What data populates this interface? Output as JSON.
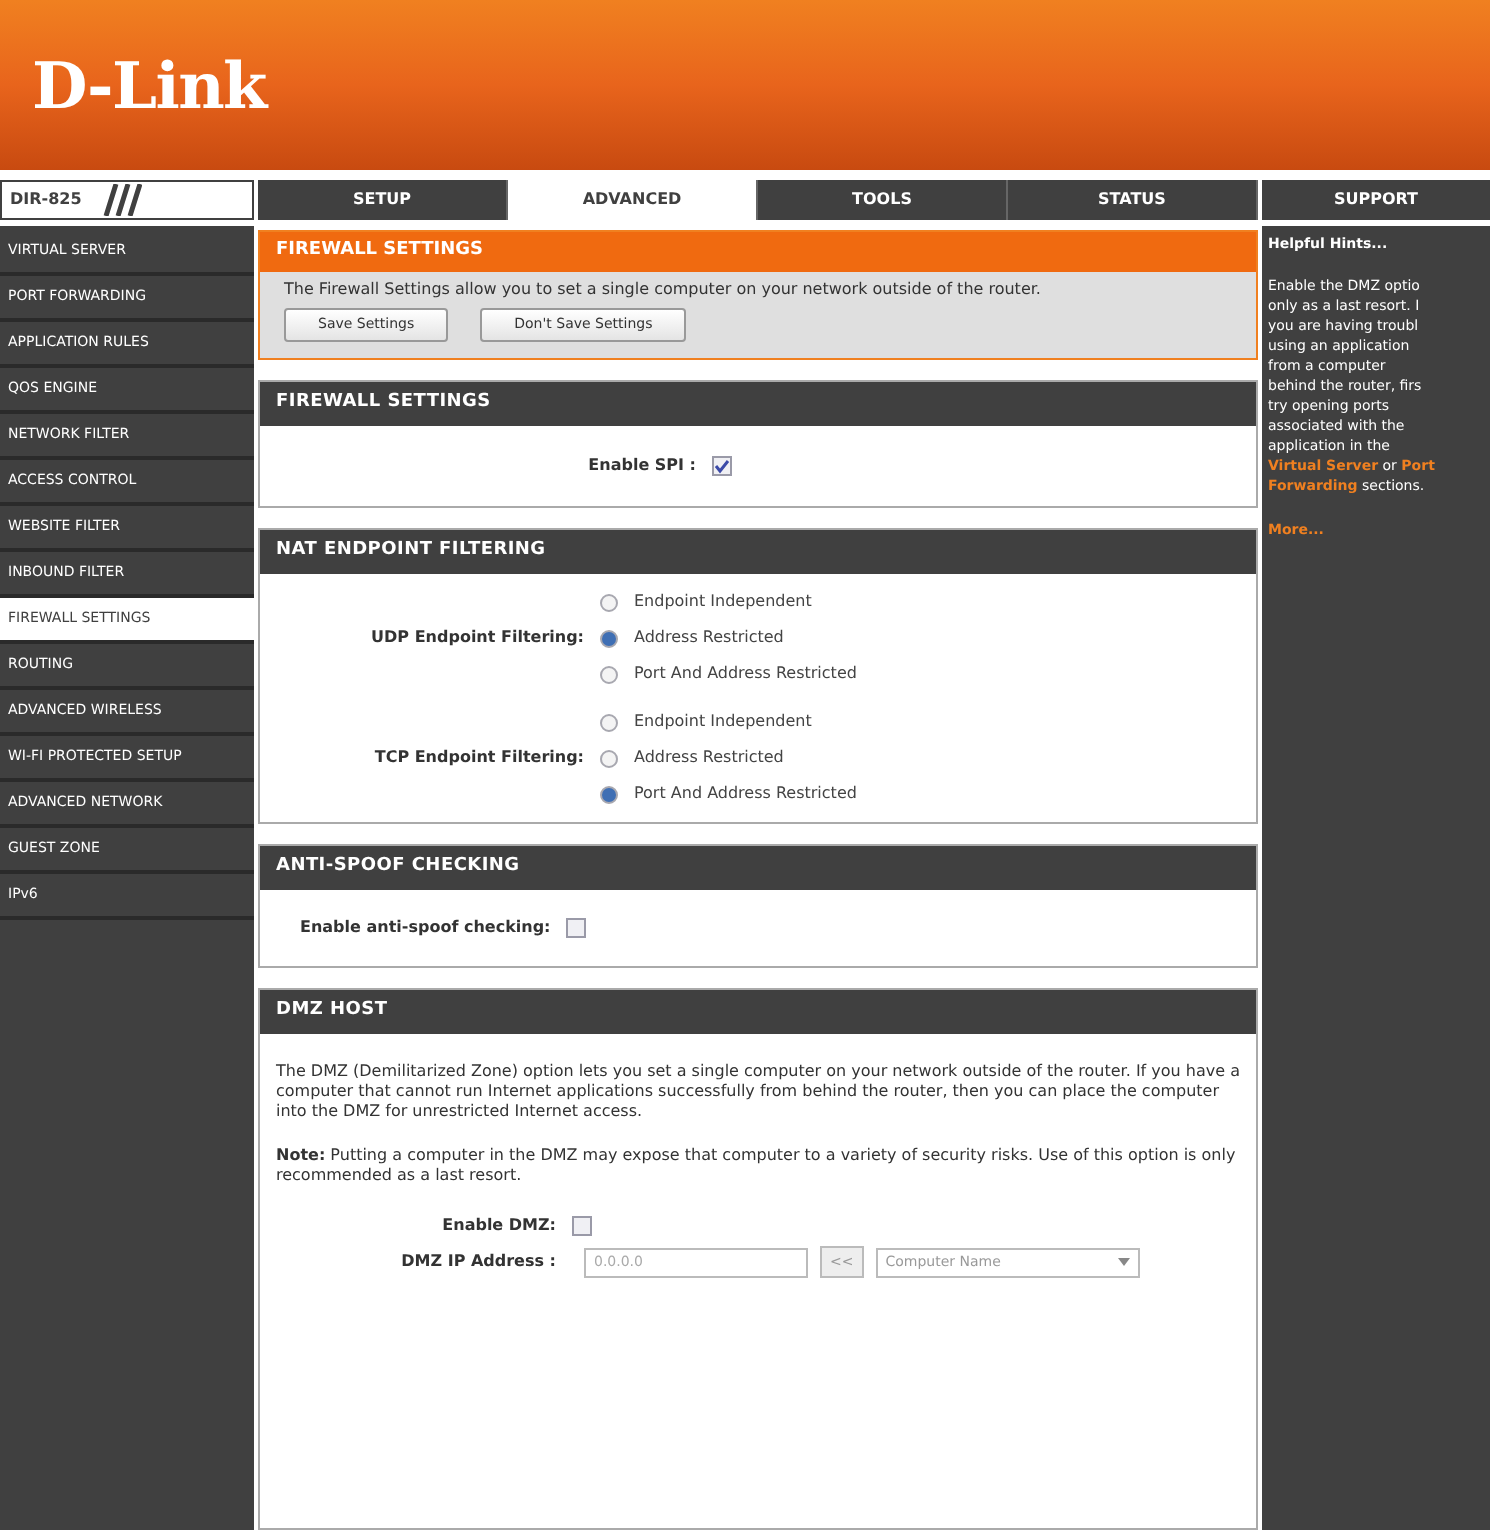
{
  "header": {
    "logo": "D-Link"
  },
  "model": "DIR-825",
  "nav": {
    "tabs": [
      {
        "label": "SETUP",
        "selected": false
      },
      {
        "label": "ADVANCED",
        "selected": true
      },
      {
        "label": "TOOLS",
        "selected": false
      },
      {
        "label": "STATUS",
        "selected": false
      }
    ],
    "support": "SUPPORT"
  },
  "sidebar": {
    "items": [
      {
        "label": "VIRTUAL SERVER",
        "selected": false
      },
      {
        "label": "PORT FORWARDING",
        "selected": false
      },
      {
        "label": "APPLICATION RULES",
        "selected": false
      },
      {
        "label": "QOS ENGINE",
        "selected": false
      },
      {
        "label": "NETWORK FILTER",
        "selected": false
      },
      {
        "label": "ACCESS CONTROL",
        "selected": false
      },
      {
        "label": "WEBSITE FILTER",
        "selected": false
      },
      {
        "label": "INBOUND FILTER",
        "selected": false
      },
      {
        "label": "FIREWALL SETTINGS",
        "selected": true
      },
      {
        "label": "ROUTING",
        "selected": false
      },
      {
        "label": "ADVANCED WIRELESS",
        "selected": false
      },
      {
        "label": "WI-FI PROTECTED SETUP",
        "selected": false
      },
      {
        "label": "ADVANCED NETWORK",
        "selected": false
      },
      {
        "label": "GUEST ZONE",
        "selected": false
      },
      {
        "label": "IPv6",
        "selected": false
      }
    ]
  },
  "intro": {
    "title": "FIREWALL SETTINGS",
    "text": "The Firewall Settings allow you to set a single computer on your network outside of the router.",
    "buttons": [
      "Save Settings",
      "Don't Save Settings"
    ]
  },
  "firewall": {
    "title": "FIREWALL SETTINGS",
    "label": "Enable SPI :",
    "checked": true
  },
  "nat": {
    "title": "NAT ENDPOINT FILTERING",
    "groups": [
      {
        "label": "UDP Endpoint Filtering:",
        "options": [
          {
            "label": "Endpoint Independent",
            "selected": false
          },
          {
            "label": "Address Restricted",
            "selected": true
          },
          {
            "label": "Port And Address Restricted",
            "selected": false
          }
        ]
      },
      {
        "label": "TCP Endpoint Filtering:",
        "options": [
          {
            "label": "Endpoint Independent",
            "selected": false
          },
          {
            "label": "Address Restricted",
            "selected": false
          },
          {
            "label": "Port And Address Restricted",
            "selected": true
          }
        ]
      }
    ]
  },
  "antispoof": {
    "title": "ANTI-SPOOF CHECKING",
    "label": "Enable anti-spoof checking:",
    "checked": false
  },
  "dmz": {
    "title": "DMZ HOST",
    "text": "The DMZ (Demilitarized Zone) option lets you set a single computer on your network outside of the router. If you have a computer that cannot run Internet applications successfully from behind the router, then you can place the computer into the DMZ for unrestricted Internet access.",
    "note": "**Note:** Putting a computer in the DMZ may expose that computer to a variety of security risks. Use of this option is only recommended as a last resort.",
    "enable_label": "Enable DMZ:",
    "enable_checked": false,
    "ip_label": "DMZ IP Address :",
    "ip_value": "0.0.0.0",
    "copy_button": "<<",
    "computer_select": "Computer Name"
  },
  "hints": {
    "title": "Helpful Hints...",
    "lines": [
      [
        {
          "text": "Enable the DMZ optio",
          "link": false
        }
      ],
      [
        {
          "text": "only as a last resort. I",
          "link": false
        }
      ],
      [
        {
          "text": "you are having troubl",
          "link": false
        }
      ],
      [
        {
          "text": "using an application",
          "link": false
        }
      ],
      [
        {
          "text": "from a computer",
          "link": false
        }
      ],
      [
        {
          "text": "behind the router, firs",
          "link": false
        }
      ],
      [
        {
          "text": "try opening ports",
          "link": false
        }
      ],
      [
        {
          "text": "associated with the",
          "link": false
        }
      ],
      [
        {
          "text": "application in the",
          "link": false
        }
      ],
      [
        {
          "text": "Virtual Server",
          "link": true
        },
        {
          "text": " or ",
          "link": false
        },
        {
          "text": "Port",
          "link": true
        }
      ],
      [
        {
          "text": "Forwarding",
          "link": true
        },
        {
          "text": " sections.",
          "link": false
        }
      ]
    ],
    "more": "More..."
  }
}
